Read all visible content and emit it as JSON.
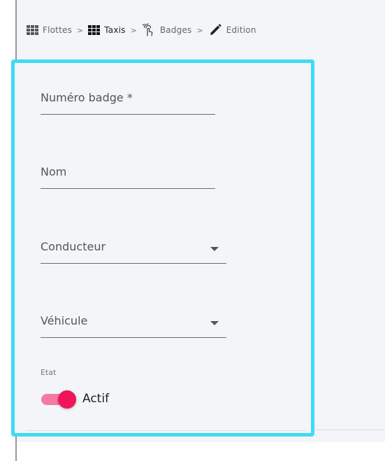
{
  "breadcrumb": {
    "items": [
      {
        "icon": "grid-icon",
        "label": "Flottes"
      },
      {
        "icon": "grid-icon",
        "label": "Taxis"
      },
      {
        "icon": "touch-gesture-icon",
        "label": "Badges"
      },
      {
        "icon": "pencil-icon",
        "label": "Edition"
      }
    ],
    "separator": ">"
  },
  "form": {
    "badge_number": {
      "label": "Numéro badge *",
      "value": ""
    },
    "name": {
      "label": "Nom",
      "value": ""
    },
    "driver": {
      "label": "Conducteur",
      "value": ""
    },
    "vehicle": {
      "label": "Véhicule",
      "value": ""
    },
    "status": {
      "label": "Etat",
      "toggle_label": "Actif",
      "enabled": true
    }
  },
  "colors": {
    "highlight_border": "#3edcf3",
    "toggle_thumb": "#f0145a",
    "toggle_track": "#f47aa6",
    "background": "#f3f5f9"
  }
}
